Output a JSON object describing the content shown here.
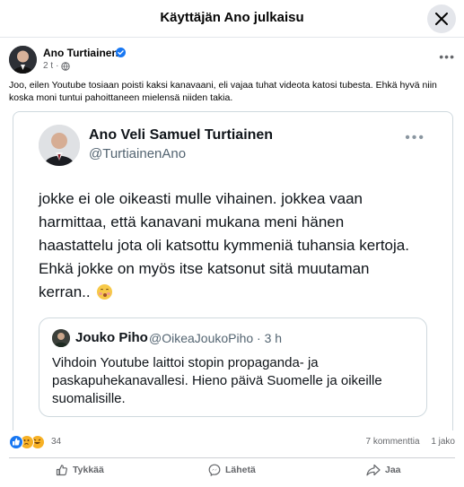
{
  "dialog": {
    "title": "Käyttäjän Ano julkaisu"
  },
  "post": {
    "author": "Ano Turtiainen",
    "time": "2 t",
    "separator": "·",
    "text": "Joo, eilen Youtube tosiaan poisti kaksi kanavaani, eli vajaa tuhat videota katosi tubesta. Ehkä hyvä niin koska moni tuntui pahoittaneen mielensä niiden takia."
  },
  "tweet": {
    "name": "Ano Veli Samuel Turtiainen",
    "handle": "@TurtiainenAno",
    "text": "jokke ei ole oikeasti mulle vihainen. jokkea vaan harmittaa, että kanavani mukana meni hänen haastattelu jota oli katsottu kymmeniä tuhansia kertoja. Ehkä jokke on myös itse katsonut sitä muutaman kerran..",
    "quote": {
      "name": "Jouko Piho",
      "handle": "@OikeaJoukoPiho · 3 h",
      "text": "Vihdoin Youtube laittoi stopin propaganda- ja paskapuhekanavallesi. Hieno päivä Suomelle ja oikeille suomalisille."
    }
  },
  "stats": {
    "reaction_count": "34",
    "comments": "7 kommenttia",
    "shares": "1 jako"
  },
  "actions": {
    "like": "Tykkää",
    "send": "Lähetä",
    "share": "Jaa"
  },
  "icons": {
    "close": "close-icon",
    "verified": "verified-badge-icon",
    "audience": "globe-icon",
    "more": "more-options-icon"
  },
  "colors": {
    "facebook_blue": "#1877f2",
    "secondary_text": "#65676b",
    "tweet_border": "#cfd9de"
  }
}
